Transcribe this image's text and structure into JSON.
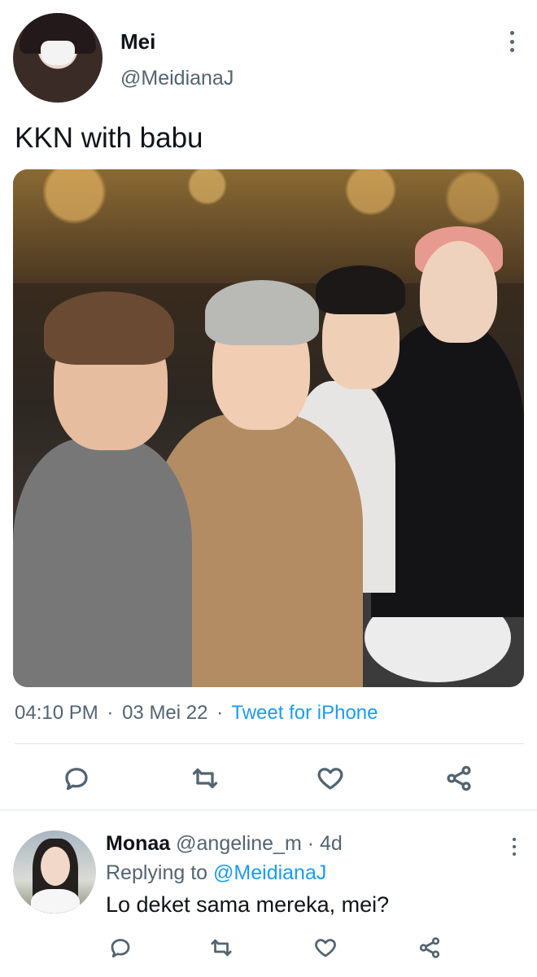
{
  "tweet": {
    "author_name": "Mei",
    "author_handle": "@MeidianaJ",
    "text": "KKN with babu",
    "time": "04:10 PM",
    "date": "03 Mei 22",
    "source": "Tweet for iPhone",
    "separator": "·"
  },
  "icons": {
    "reply": "reply-icon",
    "retweet": "retweet-icon",
    "like": "heart-icon",
    "share": "share-icon",
    "more": "more-vertical-icon"
  },
  "reply": {
    "author_name": "Monaa",
    "author_handle": "@angeline_m",
    "separator": "·",
    "time_ago": "4d",
    "replying_prefix": "Replying to",
    "replying_to": "@MeidianaJ",
    "text": "Lo deket sama mereka, mei?"
  },
  "colors": {
    "accent": "#1d9bf0",
    "secondary_text": "#536471",
    "primary_text": "#0f1419"
  }
}
